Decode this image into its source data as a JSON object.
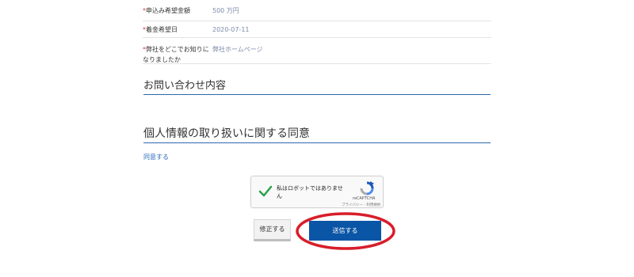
{
  "form": {
    "rows": [
      {
        "label": "申込み希望金額",
        "required_mark": "*",
        "value": "500 万円"
      },
      {
        "label": "着金希望日",
        "required_mark": "*",
        "value": "2020-07-11"
      },
      {
        "label": "弊社をどこでお知りになりましたか",
        "required_mark": "*",
        "value": "弊社ホームページ"
      }
    ]
  },
  "sections": {
    "contact_title": "お問い合わせ内容",
    "privacy_title": "個人情報の取り扱いに関する同意"
  },
  "agree_text": "同意する",
  "recaptcha": {
    "label": "私はロボットではありません",
    "brand": "reCAPTCHA",
    "terms": "プライバシー - 利用規約"
  },
  "buttons": {
    "edit": "修正する",
    "submit": "送信する"
  },
  "colors": {
    "accent": "#0b55a6",
    "section_rule": "#2f66b0",
    "highlight": "#d81e2a",
    "link": "#2a6bbd"
  }
}
